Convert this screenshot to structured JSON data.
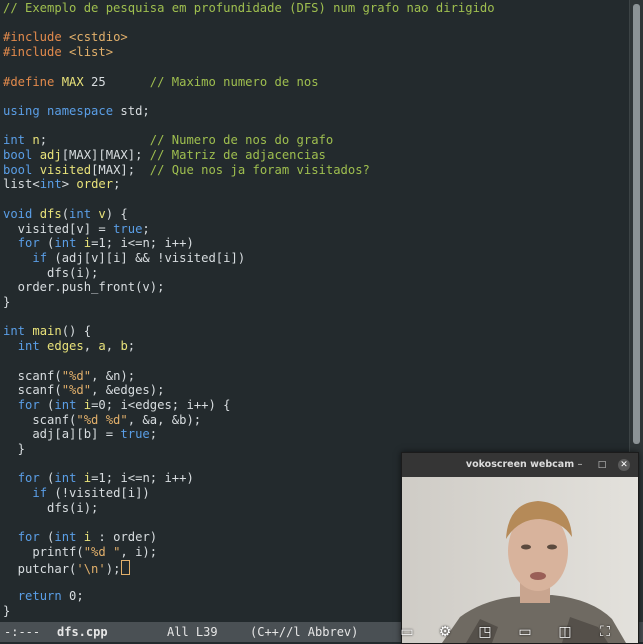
{
  "editor": {
    "lines": [
      [
        {
          "t": "// Exemplo de pesquisa em profundidade (DFS) num grafo nao dirigido",
          "c": "c"
        }
      ],
      [],
      [
        {
          "t": "#include ",
          "c": "pp"
        },
        {
          "t": "<cstdio>",
          "c": "s"
        }
      ],
      [
        {
          "t": "#include ",
          "c": "pp"
        },
        {
          "t": "<list>",
          "c": "s"
        }
      ],
      [],
      [
        {
          "t": "#define ",
          "c": "pp"
        },
        {
          "t": "MAX",
          "c": "v"
        },
        {
          "t": " 25      ",
          "c": ""
        },
        {
          "t": "// Maximo numero de nos",
          "c": "c"
        }
      ],
      [],
      [
        {
          "t": "using namespace ",
          "c": "k"
        },
        {
          "t": "std",
          "c": ""
        },
        {
          "t": ";",
          "c": ""
        }
      ],
      [],
      [
        {
          "t": "int ",
          "c": "t"
        },
        {
          "t": "n",
          "c": "v"
        },
        {
          "t": ";              ",
          "c": ""
        },
        {
          "t": "// Numero de nos do grafo",
          "c": "c"
        }
      ],
      [
        {
          "t": "bool ",
          "c": "t"
        },
        {
          "t": "adj",
          "c": "v"
        },
        {
          "t": "[MAX][MAX]; ",
          "c": ""
        },
        {
          "t": "// Matriz de adjacencias",
          "c": "c"
        }
      ],
      [
        {
          "t": "bool ",
          "c": "t"
        },
        {
          "t": "visited",
          "c": "v"
        },
        {
          "t": "[MAX];  ",
          "c": ""
        },
        {
          "t": "// Que nos ja foram visitados?",
          "c": "c"
        }
      ],
      [
        {
          "t": "list<",
          "c": ""
        },
        {
          "t": "int",
          "c": "t"
        },
        {
          "t": "> ",
          "c": ""
        },
        {
          "t": "order",
          "c": "v"
        },
        {
          "t": ";",
          "c": ""
        }
      ],
      [],
      [
        {
          "t": "void ",
          "c": "t"
        },
        {
          "t": "dfs",
          "c": "f"
        },
        {
          "t": "(",
          "c": ""
        },
        {
          "t": "int ",
          "c": "t"
        },
        {
          "t": "v",
          "c": "v"
        },
        {
          "t": ") {",
          "c": ""
        }
      ],
      [
        {
          "t": "  visited[v] = ",
          "c": ""
        },
        {
          "t": "true",
          "c": "k"
        },
        {
          "t": ";",
          "c": ""
        }
      ],
      [
        {
          "t": "  ",
          "c": ""
        },
        {
          "t": "for",
          "c": "k"
        },
        {
          "t": " (",
          "c": ""
        },
        {
          "t": "int ",
          "c": "t"
        },
        {
          "t": "i",
          "c": "v"
        },
        {
          "t": "=1; i<=n; i++)",
          "c": ""
        }
      ],
      [
        {
          "t": "    ",
          "c": ""
        },
        {
          "t": "if",
          "c": "k"
        },
        {
          "t": " (adj[v][i] && !visited[i])",
          "c": ""
        }
      ],
      [
        {
          "t": "      dfs(i);",
          "c": ""
        }
      ],
      [
        {
          "t": "  order.push_front(v);",
          "c": ""
        }
      ],
      [
        {
          "t": "}",
          "c": ""
        }
      ],
      [],
      [
        {
          "t": "int ",
          "c": "t"
        },
        {
          "t": "main",
          "c": "f"
        },
        {
          "t": "() {",
          "c": ""
        }
      ],
      [
        {
          "t": "  ",
          "c": ""
        },
        {
          "t": "int ",
          "c": "t"
        },
        {
          "t": "edges",
          "c": "v"
        },
        {
          "t": ", ",
          "c": ""
        },
        {
          "t": "a",
          "c": "v"
        },
        {
          "t": ", ",
          "c": ""
        },
        {
          "t": "b",
          "c": "v"
        },
        {
          "t": ";",
          "c": ""
        }
      ],
      [],
      [
        {
          "t": "  scanf(",
          "c": ""
        },
        {
          "t": "\"%d\"",
          "c": "s"
        },
        {
          "t": ", &n);",
          "c": ""
        }
      ],
      [
        {
          "t": "  scanf(",
          "c": ""
        },
        {
          "t": "\"%d\"",
          "c": "s"
        },
        {
          "t": ", &edges);",
          "c": ""
        }
      ],
      [
        {
          "t": "  ",
          "c": ""
        },
        {
          "t": "for",
          "c": "k"
        },
        {
          "t": " (",
          "c": ""
        },
        {
          "t": "int ",
          "c": "t"
        },
        {
          "t": "i",
          "c": "v"
        },
        {
          "t": "=0; i<edges; i++) {",
          "c": ""
        }
      ],
      [
        {
          "t": "    scanf(",
          "c": ""
        },
        {
          "t": "\"%d %d\"",
          "c": "s"
        },
        {
          "t": ", &a, &b);",
          "c": ""
        }
      ],
      [
        {
          "t": "    adj[a][b] = ",
          "c": ""
        },
        {
          "t": "true",
          "c": "k"
        },
        {
          "t": ";",
          "c": ""
        }
      ],
      [
        {
          "t": "  }",
          "c": ""
        }
      ],
      [],
      [
        {
          "t": "  ",
          "c": ""
        },
        {
          "t": "for",
          "c": "k"
        },
        {
          "t": " (",
          "c": ""
        },
        {
          "t": "int ",
          "c": "t"
        },
        {
          "t": "i",
          "c": "v"
        },
        {
          "t": "=1; i<=n; i++)",
          "c": ""
        }
      ],
      [
        {
          "t": "    ",
          "c": ""
        },
        {
          "t": "if",
          "c": "k"
        },
        {
          "t": " (!visited[i])",
          "c": ""
        }
      ],
      [
        {
          "t": "      dfs(i);",
          "c": ""
        }
      ],
      [],
      [
        {
          "t": "  ",
          "c": ""
        },
        {
          "t": "for",
          "c": "k"
        },
        {
          "t": " (",
          "c": ""
        },
        {
          "t": "int ",
          "c": "t"
        },
        {
          "t": "i",
          "c": "v"
        },
        {
          "t": " : order)",
          "c": ""
        }
      ],
      [
        {
          "t": "    printf(",
          "c": ""
        },
        {
          "t": "\"%d \"",
          "c": "s"
        },
        {
          "t": ", i);",
          "c": ""
        }
      ],
      [
        {
          "t": "  putchar(",
          "c": ""
        },
        {
          "t": "'\\n'",
          "c": "s"
        },
        {
          "t": ");",
          "c": ""
        }
      ],
      [],
      [
        {
          "t": "  ",
          "c": ""
        },
        {
          "t": "return",
          "c": "k"
        },
        {
          "t": " 0;",
          "c": ""
        }
      ],
      [
        {
          "t": "}",
          "c": ""
        }
      ]
    ],
    "cursor_line": 38
  },
  "modeline": {
    "status": "-:---",
    "buffer_name": "dfs.cpp",
    "position": "All L39",
    "mode": "(C++//l Abbrev)"
  },
  "webcam": {
    "title": "vokoscreen webcam",
    "minimize_glyph": "–",
    "maximize_glyph": "□",
    "close_glyph": "✕"
  },
  "player_controls": [
    {
      "name": "subtitles-icon",
      "glyph": "▭"
    },
    {
      "name": "settings-gear-icon",
      "glyph": "⚙"
    },
    {
      "name": "miniplayer-icon",
      "glyph": "◳"
    },
    {
      "name": "theater-mode-icon",
      "glyph": "▭"
    },
    {
      "name": "cast-icon",
      "glyph": "◫"
    },
    {
      "name": "fullscreen-icon",
      "glyph": "⛶"
    }
  ]
}
